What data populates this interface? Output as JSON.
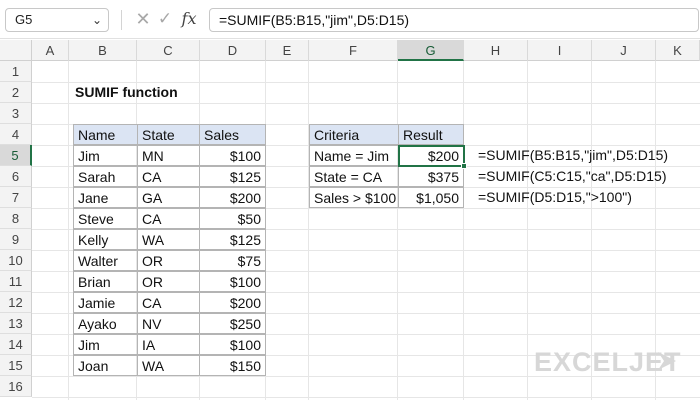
{
  "formula_bar": {
    "name_box": "G5",
    "name_box_dropdown": "chevron-down-icon",
    "formula": "=SUMIF(B5:B15,\"jim\",D5:D15)",
    "cancel_icon": "✕",
    "enter_icon": "✓",
    "fx_label": "fx"
  },
  "columns": [
    "A",
    "B",
    "C",
    "D",
    "E",
    "F",
    "G",
    "H",
    "I",
    "J",
    "K"
  ],
  "active_column": "G",
  "rows": [
    "1",
    "2",
    "3",
    "4",
    "5",
    "6",
    "7",
    "8",
    "9",
    "10",
    "11",
    "12",
    "13",
    "14",
    "15",
    "16"
  ],
  "active_row": "5",
  "sheet": {
    "title": "SUMIF function",
    "data_table": {
      "headers": [
        "Name",
        "State",
        "Sales"
      ],
      "rows": [
        {
          "name": "Jim",
          "state": "MN",
          "sales": "$100"
        },
        {
          "name": "Sarah",
          "state": "CA",
          "sales": "$125"
        },
        {
          "name": "Jane",
          "state": "GA",
          "sales": "$200"
        },
        {
          "name": "Steve",
          "state": "CA",
          "sales": "$50"
        },
        {
          "name": "Kelly",
          "state": "WA",
          "sales": "$125"
        },
        {
          "name": "Walter",
          "state": "OR",
          "sales": "$75"
        },
        {
          "name": "Brian",
          "state": "OR",
          "sales": "$100"
        },
        {
          "name": "Jamie",
          "state": "CA",
          "sales": "$200"
        },
        {
          "name": "Ayako",
          "state": "NV",
          "sales": "$250"
        },
        {
          "name": "Jim",
          "state": "IA",
          "sales": "$100"
        },
        {
          "name": "Joan",
          "state": "WA",
          "sales": "$150"
        }
      ]
    },
    "result_table": {
      "headers": [
        "Criteria",
        "Result"
      ],
      "rows": [
        {
          "criteria": "Name = Jim",
          "result": "$200",
          "formula": "=SUMIF(B5:B15,\"jim\",D5:D15)"
        },
        {
          "criteria": "State = CA",
          "result": "$375",
          "formula": "=SUMIF(C5:C15,\"ca\",D5:D15)"
        },
        {
          "criteria": "Sales > $100",
          "result": "$1,050",
          "formula": "=SUMIF(D5:D15,\">100\")"
        }
      ]
    }
  },
  "logo": {
    "text": "EXCELJET",
    "color": "#d7d7d7"
  },
  "colors": {
    "accent": "#217346",
    "header_fill": "#dbe4f3"
  }
}
